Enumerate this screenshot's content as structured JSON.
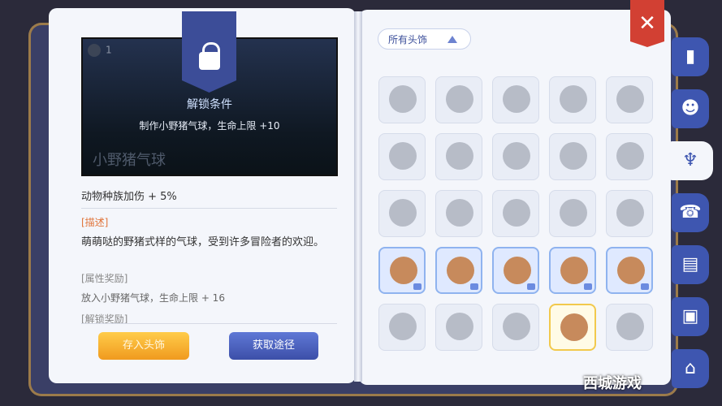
{
  "preview": {
    "count": "1",
    "item_name": "小野猪气球",
    "unlock_title": "解锁条件",
    "unlock_desc": "制作小野猪气球，生命上限 +10"
  },
  "details": {
    "bonus": "动物种族加伤 + 5%",
    "desc_head": "[描述]",
    "desc_body": "萌萌哒的野猪式样的气球，受到许多冒险者的欢迎。",
    "attr_head": "[属性奖励]",
    "attr_body": "放入小野猪气球，生命上限 + 16",
    "unlock_head": "[解锁奖励]"
  },
  "buttons": {
    "store": "存入头饰",
    "obtain": "获取途径"
  },
  "filter": {
    "label": "所有头饰"
  },
  "close": "✕",
  "tabs": [
    "▮",
    "☻",
    "♆",
    "☎",
    "▤",
    "▣",
    "⌂"
  ],
  "grid_rows": 5,
  "grid_cols": 5,
  "owned_cells": [
    15,
    16,
    17,
    18,
    19,
    23
  ],
  "selected_cell": 23,
  "watermark": "西城游戏"
}
